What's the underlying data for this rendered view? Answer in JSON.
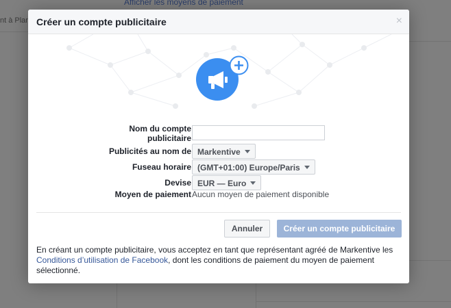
{
  "background": {
    "top_link": "Afficher les moyens de paiement",
    "left_text": "nt à Plan"
  },
  "modal": {
    "title": "Créer un compte publicitaire",
    "close_glyph": "×",
    "hero_icon": "megaphone-icon",
    "add_icon": "plus-icon",
    "form": {
      "account_name_label": "Nom du compte publicitaire",
      "account_name_value": "",
      "ads_on_behalf_label": "Publicités au nom de",
      "ads_on_behalf_value": "Markentive",
      "timezone_label": "Fuseau horaire",
      "timezone_value": "(GMT+01:00) Europe/Paris",
      "currency_label": "Devise",
      "currency_value": "EUR — Euro",
      "payment_label": "Moyen de paiement",
      "payment_value": "Aucun moyen de paiement disponible"
    },
    "buttons": {
      "cancel": "Annuler",
      "create": "Créer un compte publicitaire"
    },
    "footer": {
      "text_before": "En créant un compte publicitaire, vous acceptez en tant que représentant agréé de Markentive les ",
      "link": "Conditions d’utilisation de Facebook",
      "text_after": ", dont les conditions de paiement du moyen de paiement sélectionné."
    }
  },
  "colors": {
    "accent": "#3b8ef0",
    "create_button_disabled": "#9cb4d8",
    "link": "#365899"
  }
}
